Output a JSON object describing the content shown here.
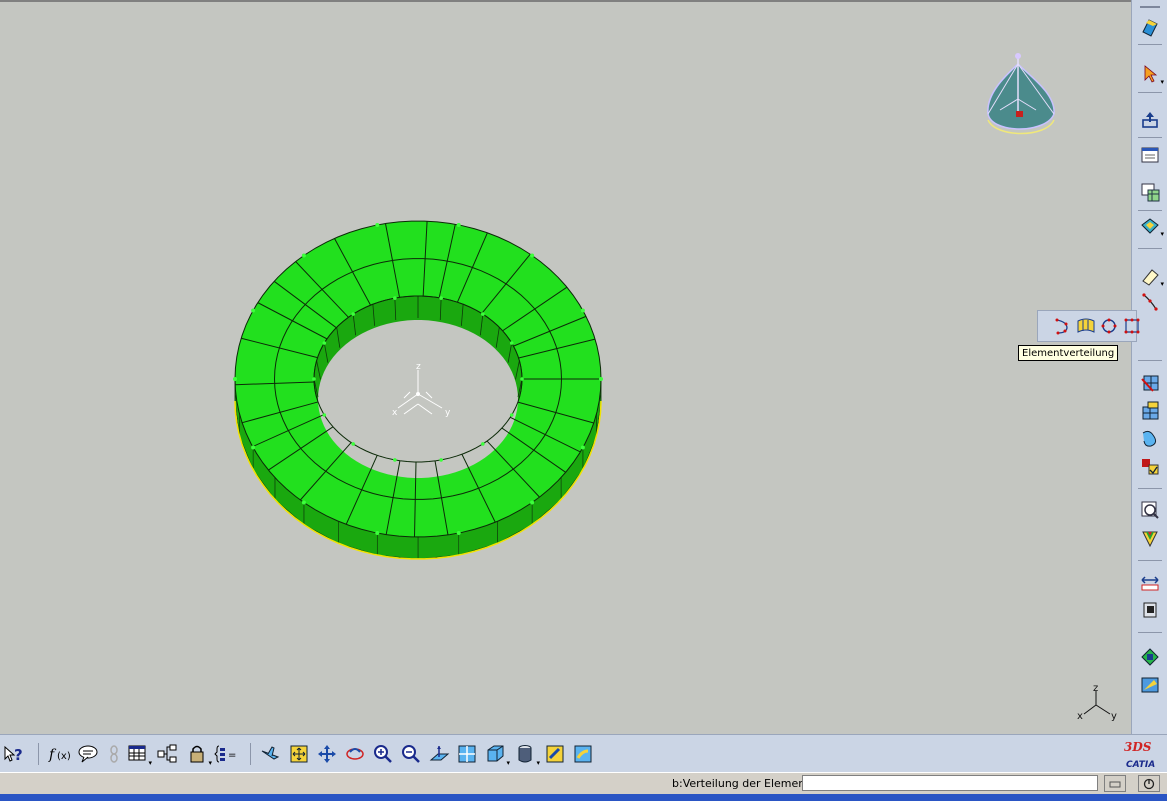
{
  "viewport": {
    "axis_labels": {
      "x": "x",
      "y": "y",
      "z": "z"
    }
  },
  "float_toolbar": {
    "tooltip": "Elementverteilung",
    "icons": [
      "edge-distribution-icon",
      "surface-distribution-icon",
      "circle-distribution-icon",
      "grid-distribution-icon"
    ]
  },
  "status": {
    "text": "b:Verteilung der Elemente",
    "command_value": ""
  },
  "brand": {
    "logo_text": "CATIA",
    "logo_mark": "3DS"
  },
  "colors": {
    "viewport_bg": "#c4c6c1",
    "mesh_green": "#22e01e",
    "mesh_side": "#1aa80f",
    "toolbar_bg": "#cbd5e5",
    "highlight_yellow": "#f0e400"
  }
}
